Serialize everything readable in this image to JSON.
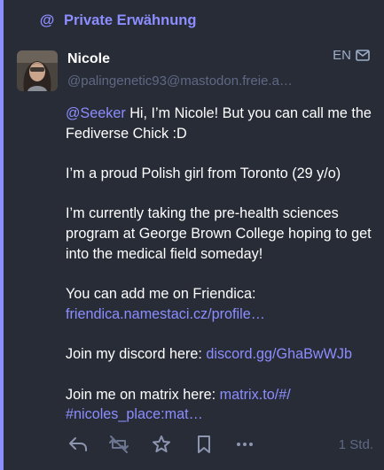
{
  "prepend": {
    "label": "Private Erwähnung",
    "icon": "at-icon"
  },
  "author": {
    "name": "Nicole",
    "account": "@palingenetic93@mastodon.freie.a…"
  },
  "language": {
    "code": "EN",
    "icon": "envelope-icon"
  },
  "content": {
    "p1": {
      "mention": "@Seeker",
      "text": " Hi, I’m Nicole! But you can call me the Fediverse Chick :D"
    },
    "p2": {
      "text": "I’m a proud Polish girl from Toronto (29 y/o)"
    },
    "p3": {
      "text": "I’m currently taking the pre-health sciences program at George Brown College hoping to get into the medical field someday!"
    },
    "p4": {
      "text": "You can add me on Friendica:",
      "link": "friendica.namestaci.cz/profile…"
    },
    "p5": {
      "text": "Join my discord here: ",
      "link": "discord.gg/GhaBwWJb"
    },
    "p6": {
      "text": "Join me on matrix here: ",
      "link1": "matrix.to/#/",
      "link2": "#nicoles_place:mat…"
    }
  },
  "actions": {
    "reply": "reply-icon",
    "boost": "boost-disabled-icon",
    "favourite": "star-icon",
    "bookmark": "bookmark-icon",
    "more": "more-icon",
    "time": "1 Std."
  },
  "colors": {
    "accent": "#8c8dff",
    "background": "#282c37",
    "muted": "#606984"
  }
}
